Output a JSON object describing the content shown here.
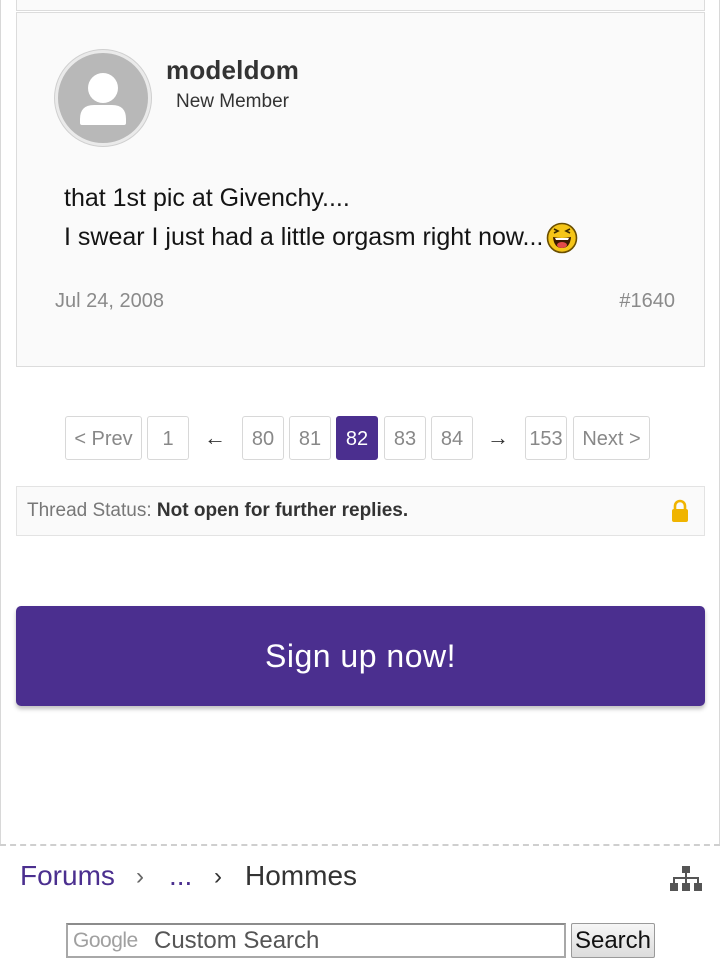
{
  "post": {
    "username": "modeldom",
    "user_title": "New Member",
    "message_line1": "that 1st pic at Givenchy....",
    "message_line2": "I swear I just had a little orgasm right now...",
    "emoji": "tongue-out-smiley-icon",
    "date": "Jul 24, 2008",
    "post_number": "#1640"
  },
  "pagination": {
    "prev_label": "< Prev",
    "first": "1",
    "left_arrow": "←",
    "pages": [
      "80",
      "81",
      "82",
      "83",
      "84"
    ],
    "current_page": "82",
    "right_arrow": "→",
    "last": "153",
    "next_label": "Next >"
  },
  "thread_status": {
    "label": "Thread Status:",
    "value": "Not open for further replies."
  },
  "signup": {
    "label": "Sign up now!"
  },
  "breadcrumb": {
    "forums": "Forums",
    "sep1": "›",
    "ellipsis": "...",
    "sep2": "›",
    "current": "Hommes"
  },
  "search": {
    "brand": "Google",
    "placeholder": "Custom Search",
    "button_label": "Search"
  },
  "colors": {
    "accent": "#4b2f8f",
    "lock": "#f0b400"
  }
}
